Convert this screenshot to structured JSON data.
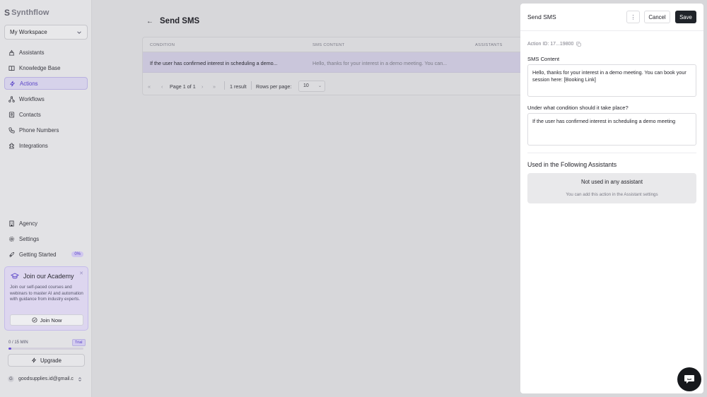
{
  "brand": {
    "name": "Synthflow"
  },
  "workspace": {
    "label": "My Workspace"
  },
  "sidebar": {
    "items": [
      {
        "label": "Assistants",
        "icon": "assistant-icon"
      },
      {
        "label": "Knowledge Base",
        "icon": "book-icon"
      },
      {
        "label": "Actions",
        "icon": "lightning-icon"
      },
      {
        "label": "Workflows",
        "icon": "workflow-icon"
      },
      {
        "label": "Contacts",
        "icon": "contact-icon"
      },
      {
        "label": "Phone Numbers",
        "icon": "phone-icon"
      },
      {
        "label": "Integrations",
        "icon": "puzzle-icon"
      }
    ],
    "bottom_items": [
      {
        "label": "Agency",
        "icon": "building-icon"
      },
      {
        "label": "Settings",
        "icon": "gear-icon"
      },
      {
        "label": "Getting Started",
        "icon": "rocket-icon",
        "badge": "0%"
      }
    ]
  },
  "academy": {
    "title": "Join our Academy",
    "description": "Join our self-paced courses and webinars to master AI and automation with guidance from industry experts.",
    "join_label": "Join Now"
  },
  "usage": {
    "label": "0 / 15 MIN",
    "plan": "Trial",
    "progress": 0.04
  },
  "upgrade_label": "Upgrade",
  "user": {
    "initial": "G",
    "email": "goodsupplies.id@gmail.c"
  },
  "page": {
    "title": "Send SMS"
  },
  "table": {
    "headers": [
      "CONDITION",
      "SMS CONTENT",
      "ASSISTANTS"
    ],
    "rows": [
      {
        "condition": "If the user has confirmed interest in scheduling a demo...",
        "sms": "Hello, thanks for your interest in a demo meeting. You can..."
      }
    ],
    "pager": {
      "page": "Page 1 of 1",
      "results": "1 result",
      "rows_label": "Rows per page:",
      "rows_value": "10"
    }
  },
  "panel": {
    "title": "Send SMS",
    "more_label": "⋮",
    "cancel_label": "Cancel",
    "save_label": "Save",
    "action_id": "Action ID: 17...19800",
    "sms_label": "SMS Content",
    "sms_value": "Hello, thanks for your interest in a demo meeting. You can book your session here: [Booking Link]",
    "condition_label": "Under what condition should it take place?",
    "condition_value": "If the user has confirmed interest in scheduling a demo meeting",
    "assistants_title": "Used in the Following Assistants",
    "empty_title": "Not used in any assistant",
    "empty_hint": "You can add this action in the Assistant settings"
  },
  "colors": {
    "accent": "#6a4fd6",
    "save_bg": "#1f2329"
  }
}
